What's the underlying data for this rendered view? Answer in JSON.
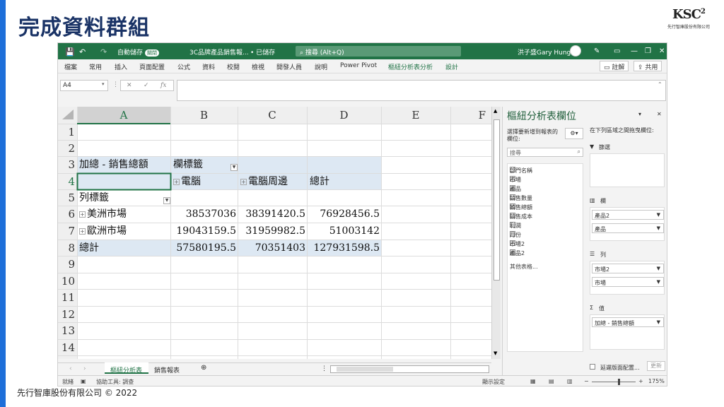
{
  "slide": {
    "title": "完成資料群組",
    "footer": "先行智庫股份有限公司 © 2022",
    "logo_text": "KSC",
    "logo_sup": "2",
    "logo_sub": "先行智庫股份有限公司"
  },
  "titlebar": {
    "autosave": "自動儲存",
    "autosave_state": "關閉",
    "filename": "3C品牌產品銷售報...",
    "saved": "• 已儲存",
    "search": "搜尋 (Alt+Q)",
    "user": "洪子盛Gary Hung"
  },
  "ribbon": {
    "tabs": [
      "檔案",
      "常用",
      "插入",
      "頁面配置",
      "公式",
      "資料",
      "校閱",
      "檢視",
      "開發人員",
      "說明",
      "Power Pivot",
      "樞紐分析表分析",
      "設計"
    ],
    "comment": "註解",
    "share": "共用"
  },
  "formula": {
    "namebox": "A4",
    "fx": "fx"
  },
  "grid": {
    "columns": [
      "A",
      "B",
      "C",
      "D",
      "E",
      "F"
    ],
    "rows": [
      "1",
      "2",
      "3",
      "4",
      "5",
      "6",
      "7",
      "8",
      "9",
      "10",
      "11",
      "12",
      "13",
      "14"
    ],
    "pivot": {
      "corner": "加總 - 銷售總額",
      "col_label": "欄標籤",
      "row_label": "列標籤",
      "col_headers": [
        "電腦",
        "電腦周邊",
        "總計"
      ],
      "data_rows": [
        {
          "label": "美洲市場",
          "values": [
            "38537036",
            "38391420.5",
            "76928456.5"
          ]
        },
        {
          "label": "歐洲市場",
          "values": [
            "19043159.5",
            "31959982.5",
            "51003142"
          ]
        }
      ],
      "total": {
        "label": "總計",
        "values": [
          "57580195.5",
          "70351403",
          "127931598.5"
        ]
      }
    }
  },
  "sheets": {
    "tabs": [
      "樞紐分析表",
      "銷售報表"
    ]
  },
  "status": {
    "ready": "就緒",
    "accessibility": "協助工具: 調查",
    "display": "顯示設定",
    "zoom": "175%"
  },
  "pane": {
    "title": "樞紐分析表欄位",
    "choose": "選擇要新增到報表的",
    "choose2": "欄位:",
    "drag": "在下列區域之間拖曳欄位:",
    "search": "搜尋",
    "fields": [
      {
        "name": "部門名稱",
        "checked": false
      },
      {
        "name": "市場",
        "checked": true
      },
      {
        "name": "產品",
        "checked": true
      },
      {
        "name": "銷售數量",
        "checked": false
      },
      {
        "name": "銷售總額",
        "checked": true
      },
      {
        "name": "銷售成本",
        "checked": false
      },
      {
        "name": "利潤",
        "checked": false
      },
      {
        "name": "月份",
        "checked": false
      },
      {
        "name": "市場2",
        "checked": true
      },
      {
        "name": "產品2",
        "checked": true
      }
    ],
    "more": "其他表格...",
    "filters": "篩選",
    "columns": "欄",
    "rows": "列",
    "values": "值",
    "col_items": [
      "產品2",
      "產品"
    ],
    "row_items": [
      "市場2",
      "市場"
    ],
    "value_items": [
      "加總 - 銷售總額"
    ],
    "defer": "延遲版面配置...",
    "update": "更新"
  }
}
